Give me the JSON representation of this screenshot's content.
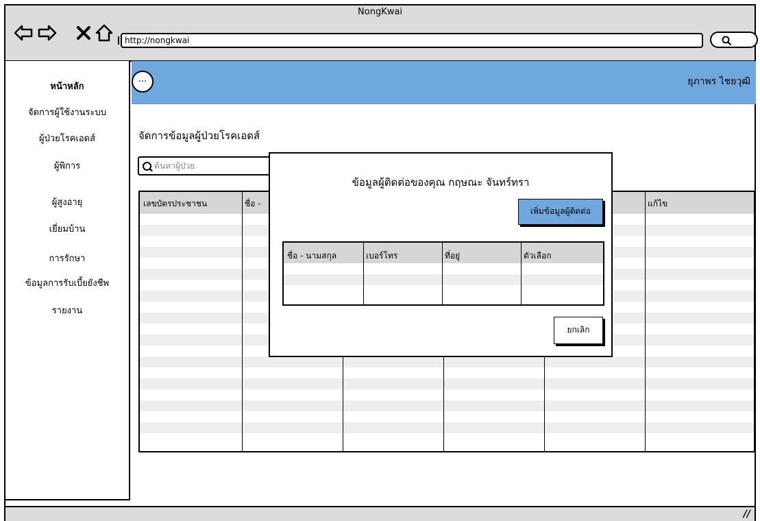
{
  "window": {
    "title": "NongKwai"
  },
  "toolbar": {
    "url": "http://nongkwai",
    "icons": [
      "back-arrow-icon",
      "forward-arrow-icon",
      "close-x-icon",
      "home-icon",
      "search-icon"
    ]
  },
  "sidebar": {
    "items": [
      {
        "label": "หน้าหลัก",
        "active": true
      },
      {
        "label": "จัดการผู้ใช้งานระบบ"
      },
      {
        "label": "ผู้ป่วยโรคเอดส์"
      },
      {
        "label": "ผู้พิการ"
      },
      {
        "label": "ผู้สูงอายุ"
      },
      {
        "label": "เยี่ยมบ้าน"
      },
      {
        "label": "การรักษา"
      },
      {
        "label": "ข้อมูลการรับเบี้ยยังชีพ"
      },
      {
        "label": "รายงาน"
      }
    ]
  },
  "header": {
    "avatar_label": "...",
    "user_name": "ยุภาพร  ไชยวุฒิ",
    "accent_color": "#6fa8dc"
  },
  "main": {
    "title": "จัดการข้อมูลผู้ป่วยโรคเอดส์",
    "search_placeholder": "ค้นหาผู้ป่วย",
    "table": {
      "columns": [
        "เลขบัตรประชาชน",
        "ชื่อ -",
        "",
        "",
        "",
        "แก้ไข"
      ]
    }
  },
  "modal": {
    "title": "ข้อมูลผู้ติดต่อของคุณ  กฤษณะ  จันทร์ทรา",
    "add_button": "เพิ่มข้อมูลผู้ติดต่อ",
    "table": {
      "columns": [
        "ชื่อ - นามสกุล",
        "เบอร์โทร",
        "ที่อยู่",
        "ตัวเลือก"
      ]
    },
    "cancel_button": "ยกเลิก"
  },
  "status": {
    "grip": "//"
  }
}
